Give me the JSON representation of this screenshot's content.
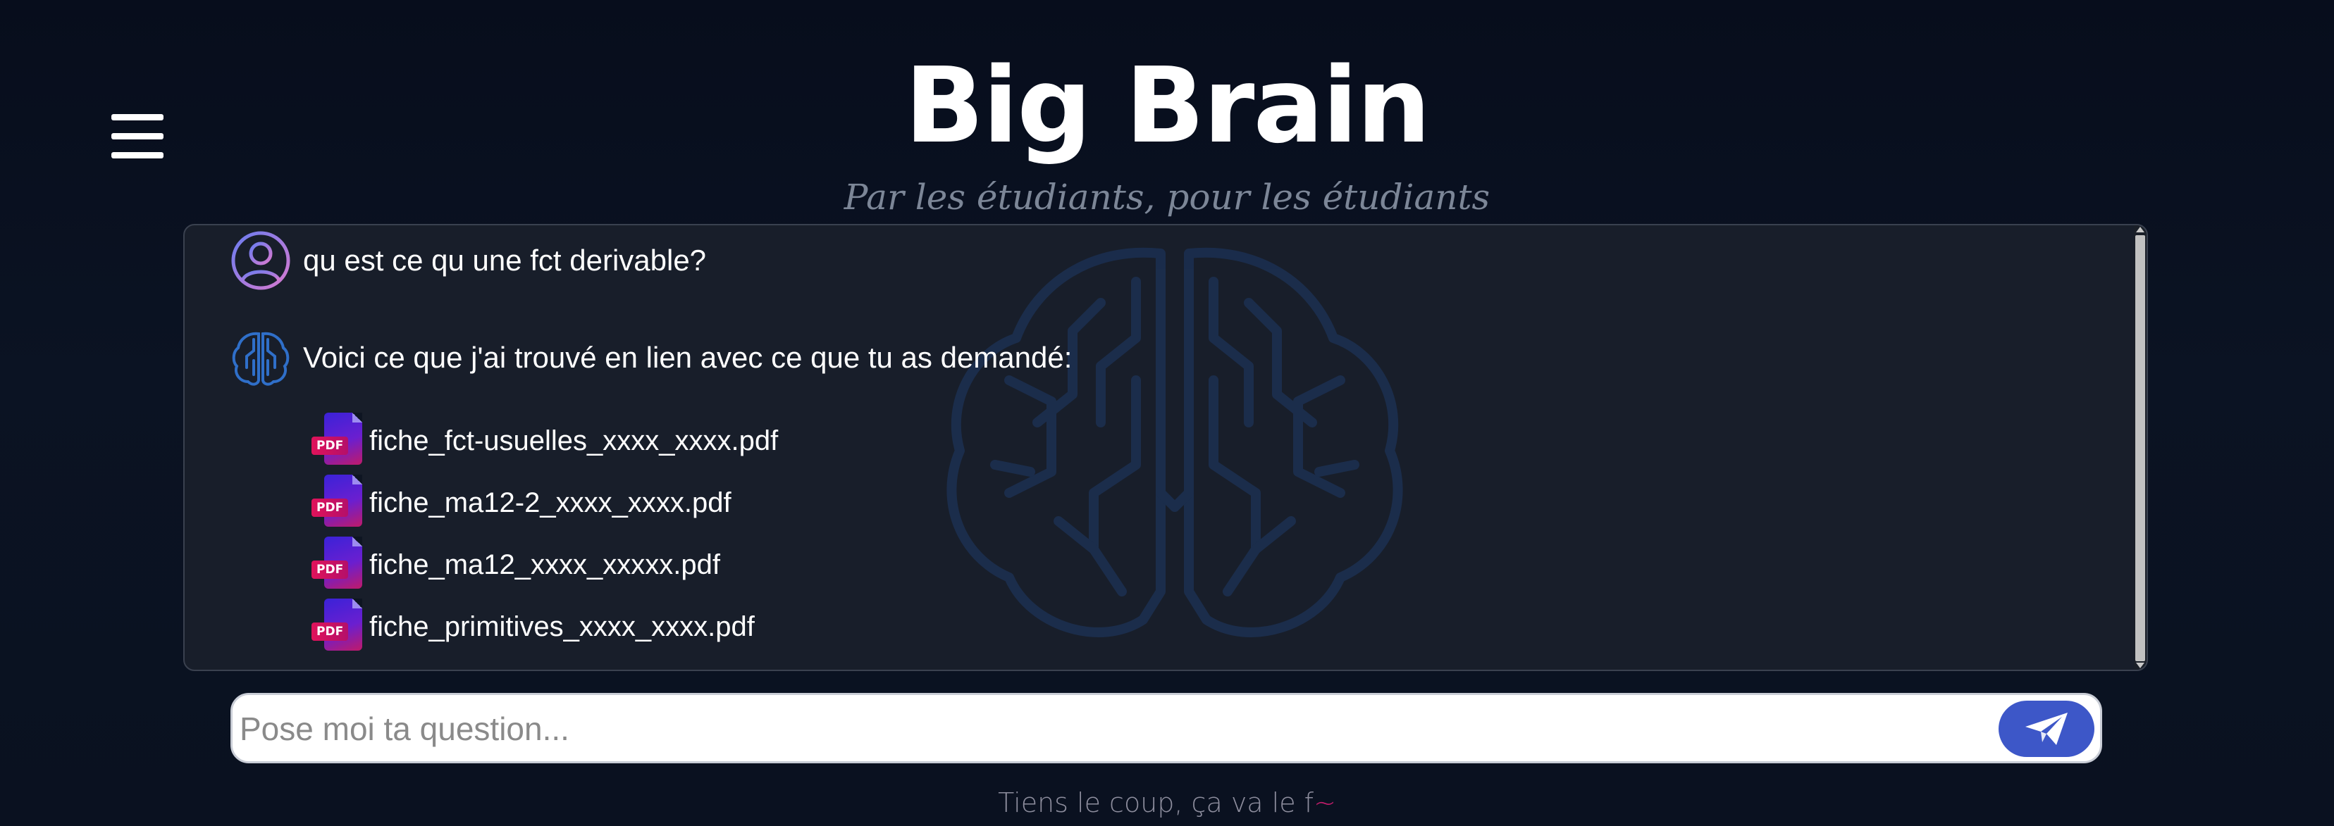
{
  "header": {
    "title": "Big Brain",
    "subtitle": "Par les étudiants, pour les étudiants",
    "menu_icon": "hamburger-menu-icon"
  },
  "chat": {
    "user_message": {
      "avatar_icon": "user-avatar-icon",
      "text": "qu est ce qu une fct derivable?"
    },
    "bot_message": {
      "avatar_icon": "brain-avatar-icon",
      "text": "Voici ce que j'ai trouvé en lien avec ce que tu as demandé:"
    },
    "files": [
      {
        "icon": "pdf-icon",
        "badge": "PDF",
        "name": "fiche_fct-usuelles_xxxx_xxxx.pdf"
      },
      {
        "icon": "pdf-icon",
        "badge": "PDF",
        "name": "fiche_ma12-2_xxxx_xxxx.pdf"
      },
      {
        "icon": "pdf-icon",
        "badge": "PDF",
        "name": "fiche_ma12_xxxx_xxxxx.pdf"
      },
      {
        "icon": "pdf-icon",
        "badge": "PDF",
        "name": "fiche_primitives_xxxx_xxxx.pdf"
      }
    ]
  },
  "input": {
    "placeholder": "Pose moi ta question...",
    "value": "",
    "send_icon": "paper-plane-icon"
  },
  "footer": {
    "text": "Tiens le coup, ça va le f",
    "trailing": "~"
  },
  "colors": {
    "background": "#0a1120",
    "panel": "#1a202b",
    "accent": "#3d57c8",
    "pdf_gradient_start": "#3a22d8",
    "pdf_gradient_end": "#e0135a"
  }
}
